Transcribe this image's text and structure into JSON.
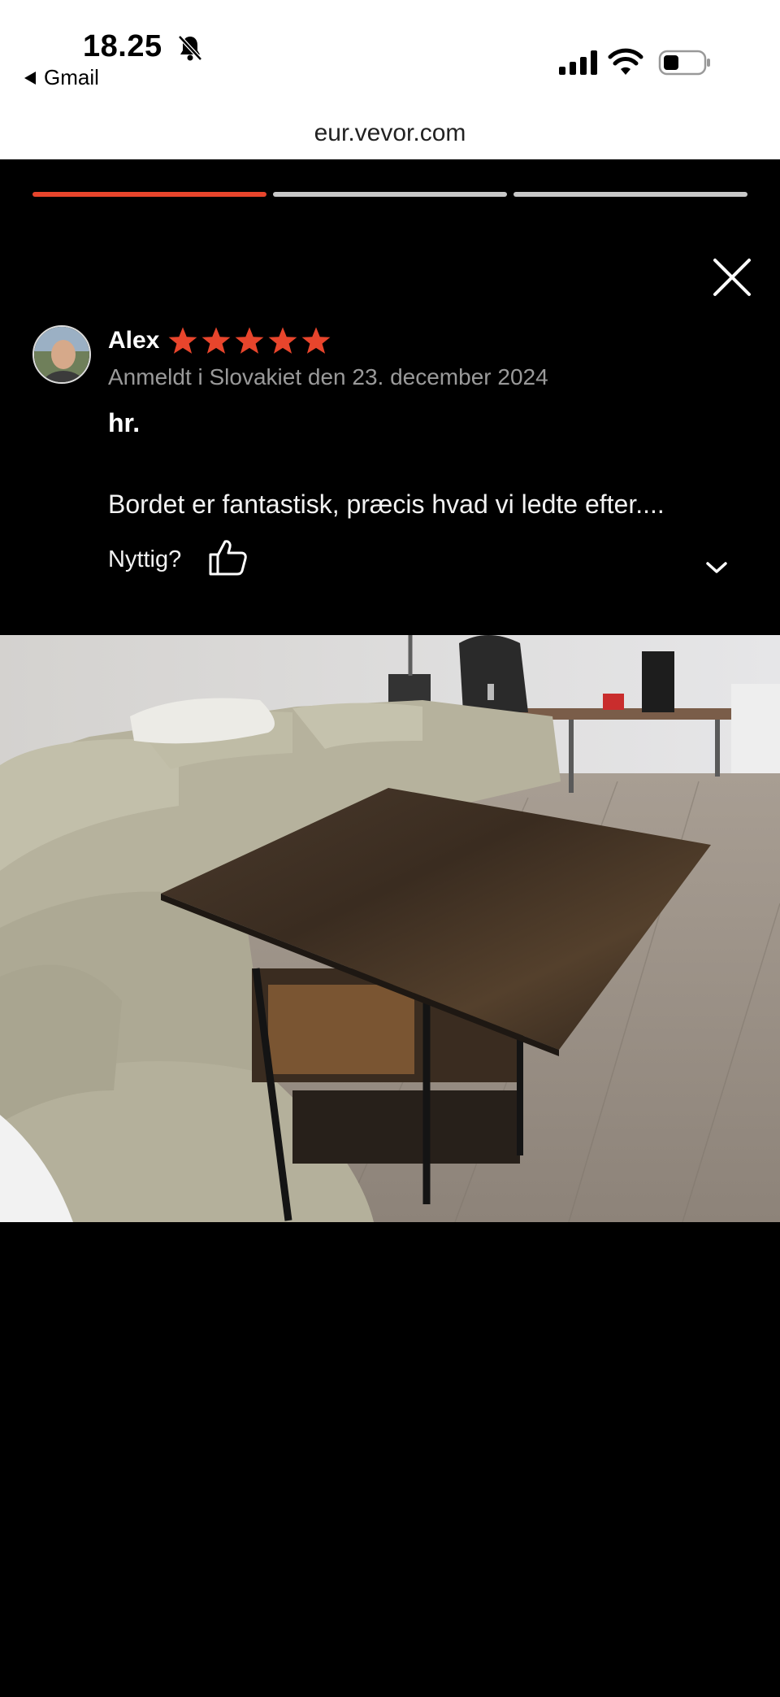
{
  "status_bar": {
    "time": "18.25",
    "back_app": "Gmail"
  },
  "browser": {
    "url": "eur.vevor.com"
  },
  "story": {
    "progress_total": 3,
    "progress_active": 1,
    "accent_color": "#e8452c"
  },
  "review": {
    "author": "Alex",
    "rating": 5,
    "rating_max": 5,
    "meta": "Anmeldt i Slovakiet den 23. december 2024",
    "title": "hr.",
    "body": "Bordet er fantastisk, præcis hvad vi ledte efter....",
    "helpful_label": "Nyttig?"
  },
  "icons": {
    "bell": "bell-slash-icon",
    "signal": "cellular-signal-icon",
    "wifi": "wifi-icon",
    "battery": "battery-icon",
    "close": "close-icon",
    "thumb": "thumbs-up-icon",
    "chevron": "chevron-down-icon",
    "star": "star-icon"
  }
}
